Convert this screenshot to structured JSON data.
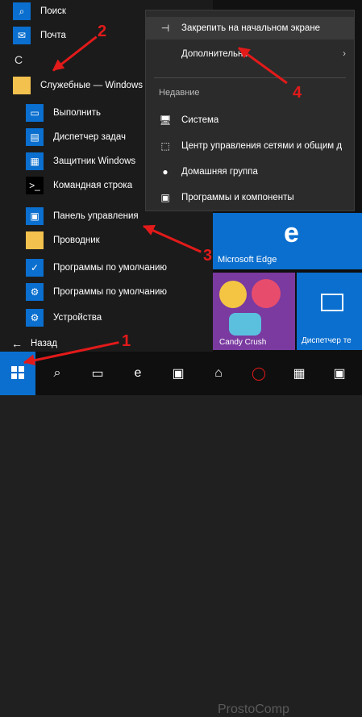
{
  "menu": {
    "search": "Поиск",
    "mail": "Почта",
    "letter_c": "С",
    "folder": "Служебные — Windows",
    "items": [
      "Выполнить",
      "Диспетчер задач",
      "Защитник Windows",
      "Командная строка",
      "Панель управления",
      "Проводник",
      "Программы по умолчанию",
      "Программы по умолчанию",
      "Устройства"
    ],
    "back": "Назад"
  },
  "context": {
    "pin": "Закрепить на начальном экране",
    "more": "Дополнительно",
    "recent_title": "Недавние",
    "recent_items": [
      "Система",
      "Центр управления сетями и общим д",
      "Домашняя группа",
      "Программы и компоненты"
    ]
  },
  "tiles": {
    "edge": "Microsoft Edge",
    "candy": "Candy Crush",
    "task_manager": "Диспетчер те"
  },
  "annotations": [
    "1",
    "2",
    "3",
    "4"
  ],
  "watermark": "ProstoComp",
  "colors": {
    "accent": "#0a6fcf",
    "menu_bg": "#1f1f1f",
    "context_bg": "#2b2b2b",
    "arrow": "#e21a1a"
  }
}
